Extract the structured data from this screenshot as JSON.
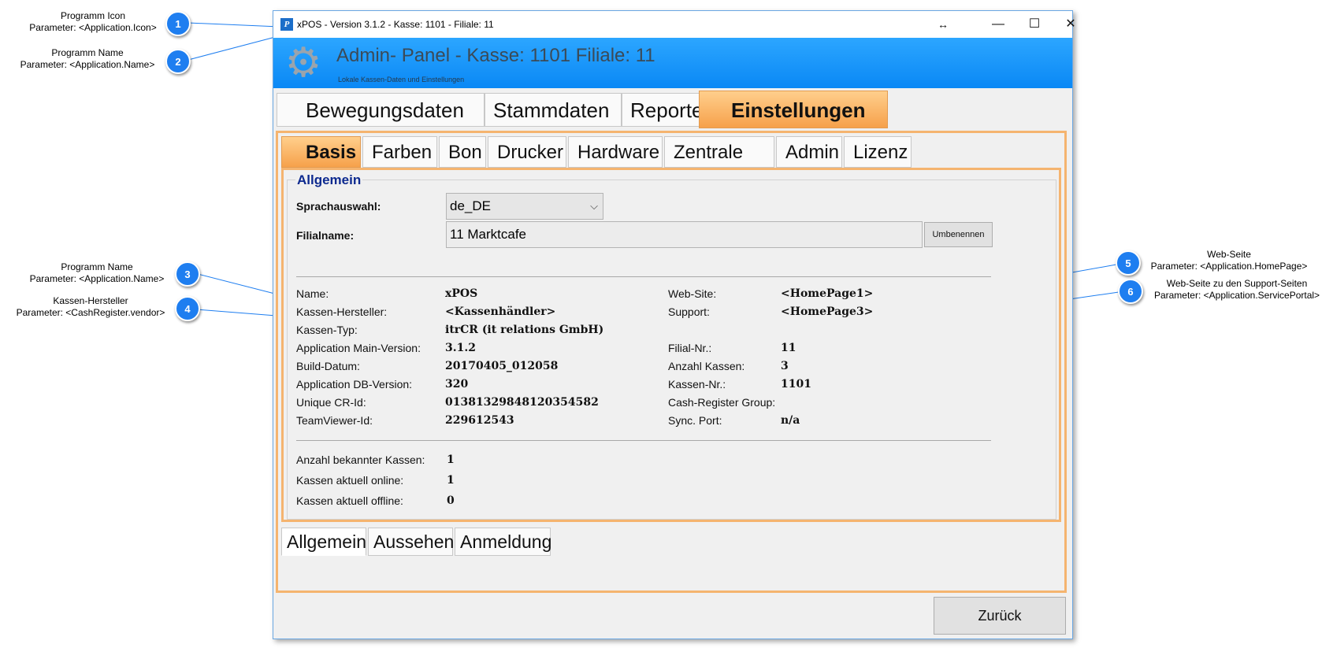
{
  "callouts": [
    {
      "num": "1",
      "line1": "Programm Icon",
      "line2": "Parameter: <Application.Icon>"
    },
    {
      "num": "2",
      "line1": "Programm Name",
      "line2": "Parameter: <Application.Name>"
    },
    {
      "num": "3",
      "line1": "Programm Name",
      "line2": "Parameter: <Application.Name>"
    },
    {
      "num": "4",
      "line1": "Kassen-Hersteller",
      "line2": "Parameter: <CashRegister.vendor>"
    },
    {
      "num": "5",
      "line1": "Web-Seite",
      "line2": "Parameter: <Application.HomePage>"
    },
    {
      "num": "6",
      "line1": "Web-Seite zu den Support-Seiten",
      "line2": "Parameter: <Application.ServicePortal>"
    }
  ],
  "window": {
    "title": "xPOS -  Version 3.1.2 - Kasse: 1101 - Filiale: 11",
    "icon": "xpos-app-icon",
    "controls": {
      "resize": "↔",
      "minimize": "—",
      "maximize": "☐",
      "close": "✕"
    }
  },
  "header": {
    "title": "Admin- Panel - Kasse: 1101 Filiale: 11",
    "subtitle": "Lokale Kassen-Daten und Einstellungen",
    "icon": "gear-icon"
  },
  "main_tabs": [
    {
      "label": "Bewegungsdaten"
    },
    {
      "label": "Stammdaten"
    },
    {
      "label": "Reporte"
    },
    {
      "label": "Einstellungen"
    }
  ],
  "sub_tabs": [
    {
      "label": "Basis"
    },
    {
      "label": "Farben"
    },
    {
      "label": "Bon"
    },
    {
      "label": "Drucker"
    },
    {
      "label": "Hardware"
    },
    {
      "label": "Zentrale DB"
    },
    {
      "label": "Admin"
    },
    {
      "label": "Lizenz"
    }
  ],
  "group": {
    "title": "Allgemein",
    "language_label": "Sprachauswahl:",
    "language_value": "de_DE",
    "branch_label": "Filialname:",
    "branch_value": "11 Marktcafe",
    "rename_button": "Umbenennen"
  },
  "info_left": [
    {
      "label": "Name:",
      "value": "xPOS"
    },
    {
      "label": "Kassen-Hersteller:",
      "value": "<Kassenhändler>"
    },
    {
      "label": "Kassen-Typ:",
      "value": "itrCR (it relations GmbH)"
    },
    {
      "label": "Application Main-Version:",
      "value": "3.1.2"
    },
    {
      "label": "Build-Datum:",
      "value": "20170405_012058"
    },
    {
      "label": "Application DB-Version:",
      "value": "320"
    },
    {
      "label": "Unique CR-Id:",
      "value": "01381329848120354582"
    },
    {
      "label": "TeamViewer-Id:",
      "value": "229612543"
    }
  ],
  "info_right": [
    {
      "label": "Web-Site:",
      "value": "<HomePage1>"
    },
    {
      "label": "Support:",
      "value": "<HomePage3>"
    },
    {
      "label": "",
      "value": ""
    },
    {
      "label": "Filial-Nr.:",
      "value": "11"
    },
    {
      "label": "Anzahl Kassen:",
      "value": "3"
    },
    {
      "label": "Kassen-Nr.:",
      "value": "1101"
    },
    {
      "label": "Cash-Register Group:",
      "value": ""
    },
    {
      "label": "Sync. Port:",
      "value": "n/a"
    }
  ],
  "stats": [
    {
      "label": "Anzahl bekannter Kassen:",
      "value": "1"
    },
    {
      "label": "Kassen aktuell online:",
      "value": "1"
    },
    {
      "label": "Kassen aktuell offline:",
      "value": "0"
    }
  ],
  "bottom_tabs": [
    {
      "label": "Allgemein"
    },
    {
      "label": "Aussehen"
    },
    {
      "label": "Anmeldung"
    }
  ],
  "back_button": "Zurück",
  "colors": {
    "accent": "#1e7ef0",
    "header_blue": "#1597fa",
    "active_tab": "#f6a14b",
    "group_title": "#0d2a8f"
  }
}
